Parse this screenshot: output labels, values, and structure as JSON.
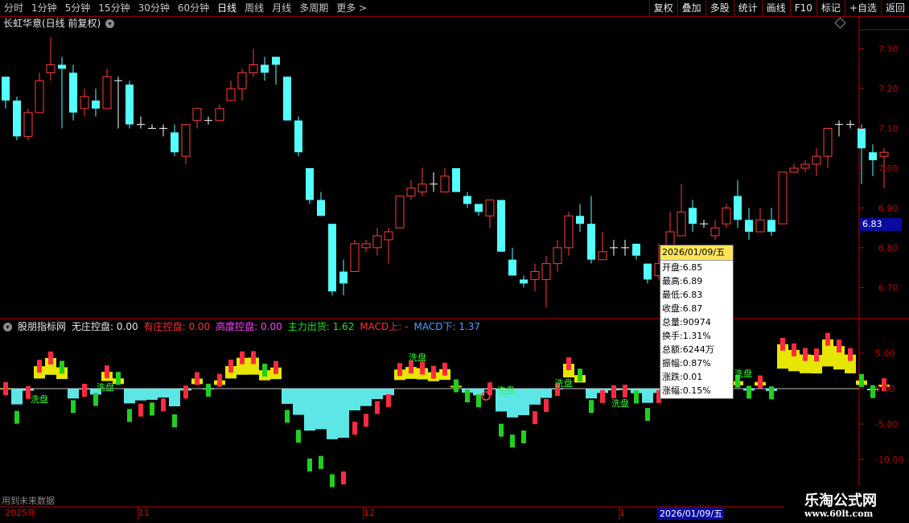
{
  "toolbar": {
    "timeframes": [
      "分时",
      "1分钟",
      "5分钟",
      "15分钟",
      "30分钟",
      "60分钟",
      "日线",
      "周线",
      "月线",
      "多周期",
      "更多 >"
    ],
    "active_timeframe": "日线",
    "tools": [
      "复权",
      "叠加",
      "多股",
      "统计",
      "画线",
      "F10",
      "标记",
      "+自选",
      "返回"
    ]
  },
  "stock": {
    "title": "长虹华意(日线 前复权)"
  },
  "price_axis": {
    "labels": [
      "7.30",
      "7.20",
      "7.10",
      "7.00",
      "6.90",
      "6.80",
      "6.70"
    ],
    "current_price": "6.83"
  },
  "indicator": {
    "name": "股朋指标网",
    "items": [
      {
        "label": "无庄控盘: 0.00",
        "color": "#e6e6e6"
      },
      {
        "label": "有庄控盘: 0.00",
        "color": "#ff3030"
      },
      {
        "label": "高度控盘: 0.00",
        "color": "#ff40ff"
      },
      {
        "label": "主力出货: 1.62",
        "color": "#20e020"
      },
      {
        "label": "MACD上: -",
        "color": "#ff3030"
      },
      {
        "label": "MACD下: 1.37",
        "color": "#4aa0ff"
      }
    ],
    "axis_labels": [
      "5.00",
      "0.00",
      "-5.00",
      "-10.00"
    ],
    "markers": [
      "洗盘",
      "洗盘",
      "洗盘",
      "洗盘",
      "洗盘",
      "洗盘",
      "洗盘"
    ]
  },
  "tooltip": {
    "date": "2026/01/09/五",
    "rows": [
      "开盘:6.85",
      "最高:6.89",
      "最低:6.83",
      "收盘:6.87",
      "总量:90974",
      "换手:1.31%",
      "总额:6244万",
      "振幅:0.87%",
      "涨跌:0.01",
      "涨幅:0.15%"
    ]
  },
  "date_axis": {
    "labels": [
      "2025年",
      "11",
      "12",
      "1"
    ],
    "cursor_date": "2026/01/09/五"
  },
  "footer": {
    "note": "用到未来数据"
  },
  "brand": {
    "name": "乐淘公式网",
    "url": "www.60lt.com"
  },
  "chart_data": {
    "type": "candlestick",
    "ylim": [
      6.65,
      7.35
    ],
    "candles": [
      [
        7.23,
        7.17,
        7.23,
        7.15
      ],
      [
        7.17,
        7.08,
        7.18,
        7.07
      ],
      [
        7.08,
        7.14,
        7.15,
        7.07
      ],
      [
        7.14,
        7.22,
        7.24,
        7.14
      ],
      [
        7.24,
        7.26,
        7.33,
        7.22
      ],
      [
        7.26,
        7.25,
        7.28,
        7.1
      ],
      [
        7.24,
        7.14,
        7.26,
        7.12
      ],
      [
        7.15,
        7.18,
        7.2,
        7.13
      ],
      [
        7.17,
        7.15,
        7.2,
        7.13
      ],
      [
        7.15,
        7.23,
        7.25,
        7.15
      ],
      [
        7.22,
        7.22,
        7.23,
        7.1
      ],
      [
        7.21,
        7.11,
        7.22,
        7.1
      ],
      [
        7.11,
        7.11,
        7.13,
        7.1
      ],
      [
        7.1,
        7.1,
        7.11,
        7.1
      ],
      [
        7.1,
        7.1,
        7.11,
        7.08
      ],
      [
        7.09,
        7.04,
        7.11,
        7.03
      ],
      [
        7.03,
        7.11,
        7.11,
        7.01
      ],
      [
        7.12,
        7.15,
        7.15,
        7.1
      ],
      [
        7.12,
        7.12,
        7.13,
        7.11
      ],
      [
        7.12,
        7.15,
        7.16,
        7.12
      ],
      [
        7.17,
        7.2,
        7.22,
        7.17
      ],
      [
        7.2,
        7.24,
        7.25,
        7.17
      ],
      [
        7.24,
        7.26,
        7.3,
        7.23
      ],
      [
        7.26,
        7.24,
        7.28,
        7.22
      ],
      [
        7.28,
        7.26,
        7.28,
        7.21
      ],
      [
        7.23,
        7.12,
        7.23,
        7.12
      ],
      [
        7.12,
        7.04,
        7.13,
        7.03
      ],
      [
        7.0,
        6.92,
        7.0,
        6.91
      ],
      [
        6.92,
        6.88,
        6.94,
        6.88
      ],
      [
        6.86,
        6.69,
        6.86,
        6.68
      ],
      [
        6.74,
        6.71,
        6.77,
        6.68
      ],
      [
        6.74,
        6.81,
        6.82,
        6.74
      ],
      [
        6.8,
        6.81,
        6.82,
        6.79
      ],
      [
        6.8,
        6.83,
        6.85,
        6.78
      ],
      [
        6.82,
        6.84,
        6.85,
        6.76
      ],
      [
        6.85,
        6.93,
        6.93,
        6.85
      ],
      [
        6.93,
        6.95,
        6.97,
        6.92
      ],
      [
        6.94,
        6.96,
        7.0,
        6.93
      ],
      [
        6.96,
        6.96,
        6.99,
        6.94
      ],
      [
        6.94,
        6.98,
        7.0,
        6.94
      ],
      [
        7.0,
        6.94,
        7.0,
        6.94
      ],
      [
        6.93,
        6.91,
        6.94,
        6.9
      ],
      [
        6.91,
        6.89,
        6.91,
        6.88
      ],
      [
        6.88,
        6.92,
        6.92,
        6.85
      ],
      [
        6.92,
        6.79,
        6.92,
        6.79
      ],
      [
        6.77,
        6.73,
        6.8,
        6.73
      ],
      [
        6.72,
        6.71,
        6.73,
        6.7
      ],
      [
        6.72,
        6.74,
        6.76,
        6.69
      ],
      [
        6.72,
        6.76,
        6.78,
        6.65
      ],
      [
        6.76,
        6.8,
        6.82,
        6.74
      ],
      [
        6.8,
        6.88,
        6.89,
        6.78
      ],
      [
        6.88,
        6.86,
        6.91,
        6.84
      ],
      [
        6.86,
        6.77,
        6.93,
        6.76
      ],
      [
        6.77,
        6.79,
        6.84,
        6.77
      ],
      [
        6.8,
        6.8,
        6.82,
        6.78
      ],
      [
        6.8,
        6.8,
        6.82,
        6.78
      ],
      [
        6.81,
        6.78,
        6.81,
        6.77
      ],
      [
        6.76,
        6.72,
        6.76,
        6.71
      ],
      [
        6.73,
        6.76,
        6.81,
        6.72
      ],
      [
        6.76,
        6.84,
        6.89,
        6.75
      ],
      [
        6.83,
        6.89,
        6.96,
        6.83
      ],
      [
        6.9,
        6.86,
        6.92,
        6.84
      ],
      [
        6.86,
        6.86,
        6.87,
        6.85
      ],
      [
        6.83,
        6.85,
        6.87,
        6.82
      ],
      [
        6.86,
        6.9,
        6.91,
        6.85
      ],
      [
        6.93,
        6.87,
        6.97,
        6.85
      ],
      [
        6.87,
        6.84,
        6.9,
        6.82
      ],
      [
        6.84,
        6.87,
        6.9,
        6.84
      ],
      [
        6.87,
        6.84,
        6.9,
        6.83
      ],
      [
        6.86,
        6.99,
        6.99,
        6.86
      ],
      [
        6.99,
        7.0,
        7.01,
        6.99
      ],
      [
        7.0,
        7.01,
        7.02,
        6.99
      ],
      [
        7.01,
        7.03,
        7.05,
        6.98
      ],
      [
        7.03,
        7.1,
        7.1,
        7.0
      ],
      [
        7.11,
        7.11,
        7.12,
        7.08
      ],
      [
        7.11,
        7.11,
        7.12,
        7.1
      ],
      [
        7.1,
        7.05,
        7.11,
        6.96
      ],
      [
        7.04,
        7.02,
        7.06,
        6.98
      ],
      [
        7.03,
        7.04,
        7.05,
        6.95
      ]
    ]
  }
}
